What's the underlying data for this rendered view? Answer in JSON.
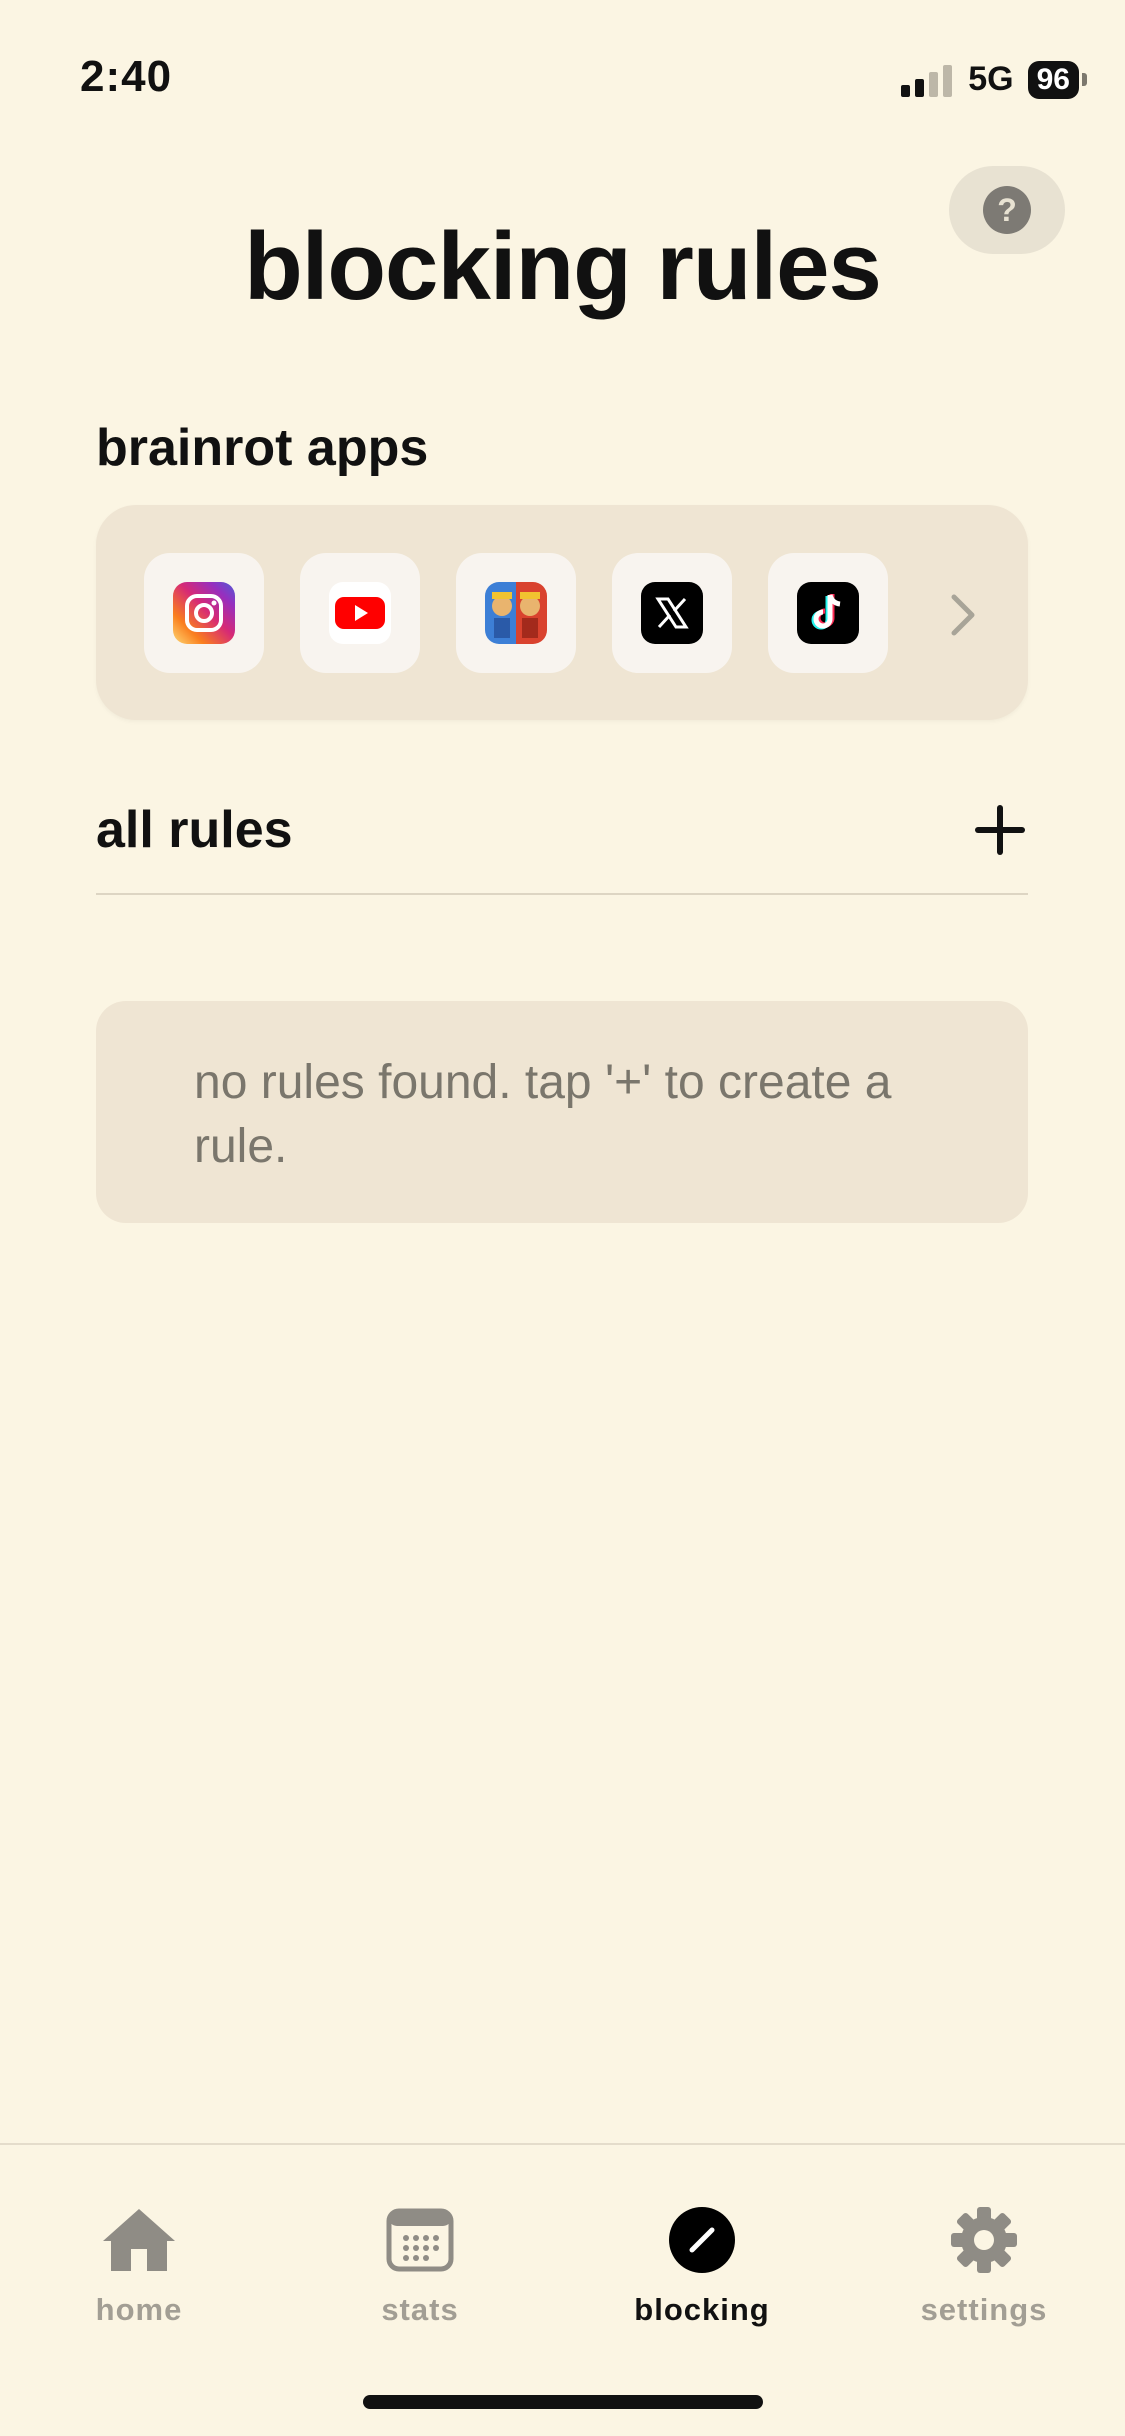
{
  "status_bar": {
    "time": "2:40",
    "network": "5G",
    "battery": "96",
    "signal_bars_filled": 2,
    "signal_bars_total": 4
  },
  "header": {
    "help_label": "?",
    "title": "blocking rules"
  },
  "brainrot": {
    "section_label": "brainrot apps",
    "apps": [
      {
        "name": "instagram",
        "icon": "instagram-icon"
      },
      {
        "name": "youtube",
        "icon": "youtube-icon"
      },
      {
        "name": "clash-royale",
        "icon": "game-icon"
      },
      {
        "name": "x",
        "icon": "x-icon"
      },
      {
        "name": "tiktok",
        "icon": "tiktok-icon"
      }
    ],
    "more_icon": "chevron-right-icon"
  },
  "rules": {
    "section_label": "all rules",
    "add_icon": "plus-icon",
    "empty_message": "no rules found. tap '+' to create a rule."
  },
  "tabbar": {
    "tabs": [
      {
        "label": "home",
        "icon": "house-icon",
        "active": false
      },
      {
        "label": "stats",
        "icon": "calendar-icon",
        "active": false
      },
      {
        "label": "blocking",
        "icon": "block-icon",
        "active": true
      },
      {
        "label": "settings",
        "icon": "gear-icon",
        "active": false
      }
    ]
  },
  "colors": {
    "background": "#fbf5e3",
    "card": "#efe5d3",
    "muted_text": "#7a766c",
    "inactive_tab": "#a29e94",
    "active_tab": "#111111"
  }
}
